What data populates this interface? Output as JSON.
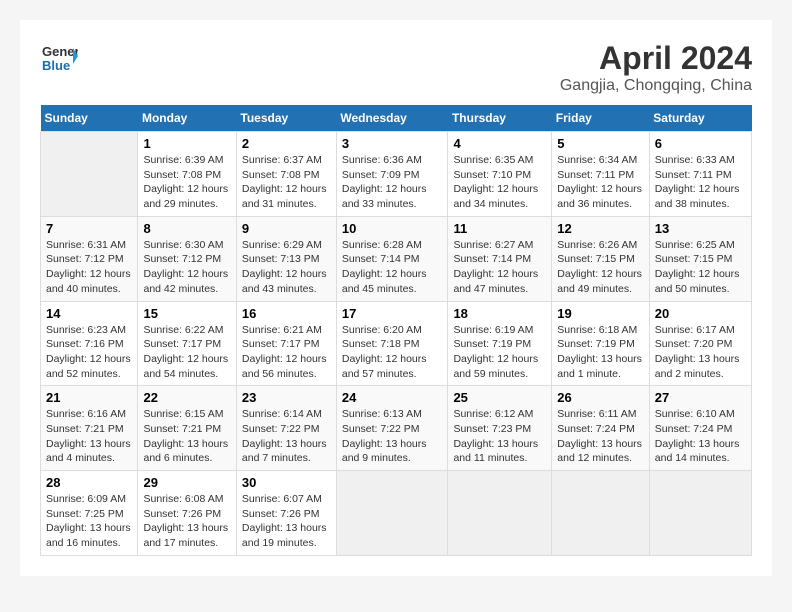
{
  "header": {
    "logo_general": "General",
    "logo_blue": "Blue",
    "title": "April 2024",
    "subtitle": "Gangjia, Chongqing, China"
  },
  "weekdays": [
    "Sunday",
    "Monday",
    "Tuesday",
    "Wednesday",
    "Thursday",
    "Friday",
    "Saturday"
  ],
  "weeks": [
    {
      "days": [
        {
          "num": "",
          "sunrise": "",
          "sunset": "",
          "daylight": ""
        },
        {
          "num": "1",
          "sunrise": "Sunrise: 6:39 AM",
          "sunset": "Sunset: 7:08 PM",
          "daylight": "Daylight: 12 hours and 29 minutes."
        },
        {
          "num": "2",
          "sunrise": "Sunrise: 6:37 AM",
          "sunset": "Sunset: 7:08 PM",
          "daylight": "Daylight: 12 hours and 31 minutes."
        },
        {
          "num": "3",
          "sunrise": "Sunrise: 6:36 AM",
          "sunset": "Sunset: 7:09 PM",
          "daylight": "Daylight: 12 hours and 33 minutes."
        },
        {
          "num": "4",
          "sunrise": "Sunrise: 6:35 AM",
          "sunset": "Sunset: 7:10 PM",
          "daylight": "Daylight: 12 hours and 34 minutes."
        },
        {
          "num": "5",
          "sunrise": "Sunrise: 6:34 AM",
          "sunset": "Sunset: 7:11 PM",
          "daylight": "Daylight: 12 hours and 36 minutes."
        },
        {
          "num": "6",
          "sunrise": "Sunrise: 6:33 AM",
          "sunset": "Sunset: 7:11 PM",
          "daylight": "Daylight: 12 hours and 38 minutes."
        }
      ]
    },
    {
      "days": [
        {
          "num": "7",
          "sunrise": "Sunrise: 6:31 AM",
          "sunset": "Sunset: 7:12 PM",
          "daylight": "Daylight: 12 hours and 40 minutes."
        },
        {
          "num": "8",
          "sunrise": "Sunrise: 6:30 AM",
          "sunset": "Sunset: 7:12 PM",
          "daylight": "Daylight: 12 hours and 42 minutes."
        },
        {
          "num": "9",
          "sunrise": "Sunrise: 6:29 AM",
          "sunset": "Sunset: 7:13 PM",
          "daylight": "Daylight: 12 hours and 43 minutes."
        },
        {
          "num": "10",
          "sunrise": "Sunrise: 6:28 AM",
          "sunset": "Sunset: 7:14 PM",
          "daylight": "Daylight: 12 hours and 45 minutes."
        },
        {
          "num": "11",
          "sunrise": "Sunrise: 6:27 AM",
          "sunset": "Sunset: 7:14 PM",
          "daylight": "Daylight: 12 hours and 47 minutes."
        },
        {
          "num": "12",
          "sunrise": "Sunrise: 6:26 AM",
          "sunset": "Sunset: 7:15 PM",
          "daylight": "Daylight: 12 hours and 49 minutes."
        },
        {
          "num": "13",
          "sunrise": "Sunrise: 6:25 AM",
          "sunset": "Sunset: 7:15 PM",
          "daylight": "Daylight: 12 hours and 50 minutes."
        }
      ]
    },
    {
      "days": [
        {
          "num": "14",
          "sunrise": "Sunrise: 6:23 AM",
          "sunset": "Sunset: 7:16 PM",
          "daylight": "Daylight: 12 hours and 52 minutes."
        },
        {
          "num": "15",
          "sunrise": "Sunrise: 6:22 AM",
          "sunset": "Sunset: 7:17 PM",
          "daylight": "Daylight: 12 hours and 54 minutes."
        },
        {
          "num": "16",
          "sunrise": "Sunrise: 6:21 AM",
          "sunset": "Sunset: 7:17 PM",
          "daylight": "Daylight: 12 hours and 56 minutes."
        },
        {
          "num": "17",
          "sunrise": "Sunrise: 6:20 AM",
          "sunset": "Sunset: 7:18 PM",
          "daylight": "Daylight: 12 hours and 57 minutes."
        },
        {
          "num": "18",
          "sunrise": "Sunrise: 6:19 AM",
          "sunset": "Sunset: 7:19 PM",
          "daylight": "Daylight: 12 hours and 59 minutes."
        },
        {
          "num": "19",
          "sunrise": "Sunrise: 6:18 AM",
          "sunset": "Sunset: 7:19 PM",
          "daylight": "Daylight: 13 hours and 1 minute."
        },
        {
          "num": "20",
          "sunrise": "Sunrise: 6:17 AM",
          "sunset": "Sunset: 7:20 PM",
          "daylight": "Daylight: 13 hours and 2 minutes."
        }
      ]
    },
    {
      "days": [
        {
          "num": "21",
          "sunrise": "Sunrise: 6:16 AM",
          "sunset": "Sunset: 7:21 PM",
          "daylight": "Daylight: 13 hours and 4 minutes."
        },
        {
          "num": "22",
          "sunrise": "Sunrise: 6:15 AM",
          "sunset": "Sunset: 7:21 PM",
          "daylight": "Daylight: 13 hours and 6 minutes."
        },
        {
          "num": "23",
          "sunrise": "Sunrise: 6:14 AM",
          "sunset": "Sunset: 7:22 PM",
          "daylight": "Daylight: 13 hours and 7 minutes."
        },
        {
          "num": "24",
          "sunrise": "Sunrise: 6:13 AM",
          "sunset": "Sunset: 7:22 PM",
          "daylight": "Daylight: 13 hours and 9 minutes."
        },
        {
          "num": "25",
          "sunrise": "Sunrise: 6:12 AM",
          "sunset": "Sunset: 7:23 PM",
          "daylight": "Daylight: 13 hours and 11 minutes."
        },
        {
          "num": "26",
          "sunrise": "Sunrise: 6:11 AM",
          "sunset": "Sunset: 7:24 PM",
          "daylight": "Daylight: 13 hours and 12 minutes."
        },
        {
          "num": "27",
          "sunrise": "Sunrise: 6:10 AM",
          "sunset": "Sunset: 7:24 PM",
          "daylight": "Daylight: 13 hours and 14 minutes."
        }
      ]
    },
    {
      "days": [
        {
          "num": "28",
          "sunrise": "Sunrise: 6:09 AM",
          "sunset": "Sunset: 7:25 PM",
          "daylight": "Daylight: 13 hours and 16 minutes."
        },
        {
          "num": "29",
          "sunrise": "Sunrise: 6:08 AM",
          "sunset": "Sunset: 7:26 PM",
          "daylight": "Daylight: 13 hours and 17 minutes."
        },
        {
          "num": "30",
          "sunrise": "Sunrise: 6:07 AM",
          "sunset": "Sunset: 7:26 PM",
          "daylight": "Daylight: 13 hours and 19 minutes."
        },
        {
          "num": "",
          "sunrise": "",
          "sunset": "",
          "daylight": ""
        },
        {
          "num": "",
          "sunrise": "",
          "sunset": "",
          "daylight": ""
        },
        {
          "num": "",
          "sunrise": "",
          "sunset": "",
          "daylight": ""
        },
        {
          "num": "",
          "sunrise": "",
          "sunset": "",
          "daylight": ""
        }
      ]
    }
  ]
}
